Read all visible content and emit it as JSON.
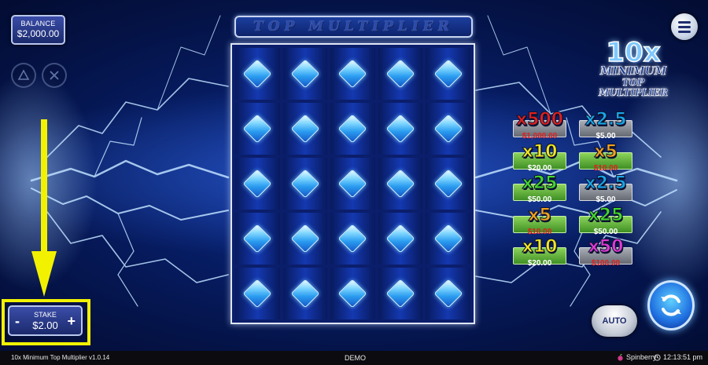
{
  "balance": {
    "label": "BALANCE",
    "value": "$2,000.00"
  },
  "title": "TOP MULTIPLIER",
  "logo": {
    "big": "10x",
    "line1": "MINIMUM",
    "line2": "TOP MULTIPLIER"
  },
  "grid": {
    "rows": 5,
    "cols": 5,
    "symbol": "blue-diamond-gem"
  },
  "prizes": [
    {
      "mult": "x500",
      "value": "$1,000.00",
      "mult_color": "#e0201f",
      "value_color": "#e0201f",
      "plate": "grey"
    },
    {
      "mult": "x2.5",
      "value": "$5.00",
      "mult_color": "#18a6e6",
      "value_color": "#ffffff",
      "plate": "grey"
    },
    {
      "mult": "x10",
      "value": "$20.00",
      "mult_color": "#f3e620",
      "value_color": "#ffffff",
      "plate": "green"
    },
    {
      "mult": "x5",
      "value": "$10.00",
      "mult_color": "#f2a21c",
      "value_color": "#e0201f",
      "plate": "green"
    },
    {
      "mult": "x25",
      "value": "$50.00",
      "mult_color": "#43d82b",
      "value_color": "#ffffff",
      "plate": "green"
    },
    {
      "mult": "x2.5",
      "value": "$5.00",
      "mult_color": "#18a6e6",
      "value_color": "#ffffff",
      "plate": "grey"
    },
    {
      "mult": "x5",
      "value": "$10.00",
      "mult_color": "#f2a21c",
      "value_color": "#e0201f",
      "plate": "green"
    },
    {
      "mult": "x25",
      "value": "$50.00",
      "mult_color": "#43d82b",
      "value_color": "#ffffff",
      "plate": "green"
    },
    {
      "mult": "x10",
      "value": "$20.00",
      "mult_color": "#f3e620",
      "value_color": "#ffffff",
      "plate": "green"
    },
    {
      "mult": "x50",
      "value": "$100.00",
      "mult_color": "#e23ad6",
      "value_color": "#e0201f",
      "plate": "grey"
    }
  ],
  "buttons": {
    "auto": "AUTO"
  },
  "stake": {
    "label": "STAKE",
    "value": "$2.00",
    "minus": "-",
    "plus": "+"
  },
  "status": {
    "version": "10x Minimum Top Multiplier v1.0.14",
    "mode": "DEMO",
    "brand": "Spinberry",
    "time": "12:13:51 pm"
  },
  "colors": {
    "highlight": "#f2f200",
    "accent": "#1f6fe0"
  }
}
